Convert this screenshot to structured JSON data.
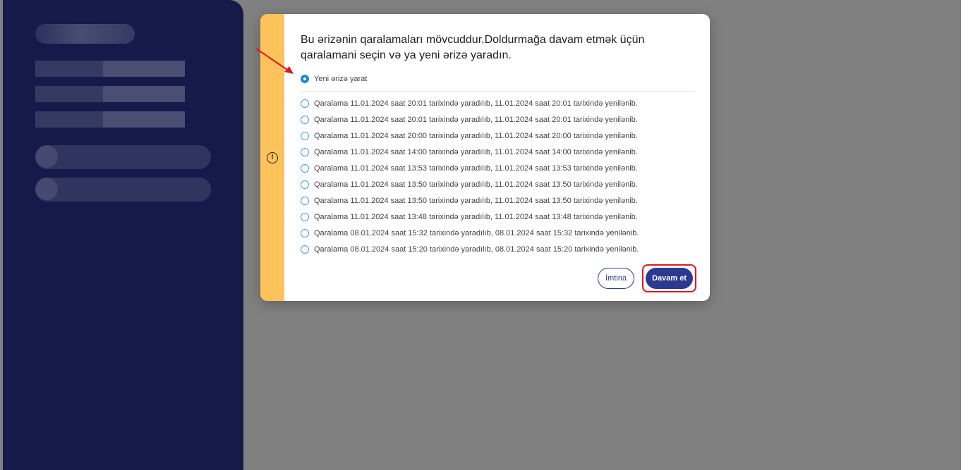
{
  "dialog": {
    "title": "Bu ərizənin qaralamaları mövcuddur.Doldurmağa davam etmək üçün qaralamani seçin və ya yeni ərizə yaradın.",
    "new_option": "Yeni ərizə yarat",
    "drafts": [
      "Qaralama 11.01.2024 saat 20:01 tarixində yaradılıb, 11.01.2024 saat 20:01 tarixində yenilənib.",
      "Qaralama 11.01.2024 saat 20:01 tarixində yaradılıb, 11.01.2024 saat 20:01 tarixində yenilənib.",
      "Qaralama 11.01.2024 saat 20:00 tarixində yaradılıb, 11.01.2024 saat 20:00 tarixində yenilənib.",
      "Qaralama 11.01.2024 saat 14:00 tarixində yaradılıb, 11.01.2024 saat 14:00 tarixində yenilənib.",
      "Qaralama 11.01.2024 saat 13:53 tarixində yaradılıb, 11.01.2024 saat 13:53 tarixində yenilənib.",
      "Qaralama 11.01.2024 saat 13:50 tarixində yaradılıb, 11.01.2024 saat 13:50 tarixində yenilənib.",
      "Qaralama 11.01.2024 saat 13:50 tarixində yaradılıb, 11.01.2024 saat 13:50 tarixində yenilənib.",
      "Qaralama 11.01.2024 saat 13:48 tarixində yaradılıb, 11.01.2024 saat 13:48 tarixində yenilənib.",
      "Qaralama 08.01.2024 saat 15:32 tarixində yaradılıb, 08.01.2024 saat 15:32 tarixində yenilənib.",
      "Qaralama 08.01.2024 saat 15:20 tarixində yaradılıb, 08.01.2024 saat 15:20 tarixində yenilənib."
    ],
    "cancel_label": "İmtina",
    "continue_label": "Davam et",
    "warning_icon": "exclamation-circle-icon"
  },
  "colors": {
    "sidebar": "#141a4a",
    "overlay": "#808080",
    "stripe": "#fdc35a",
    "primary": "#2b3a8f",
    "radio": "#1d8ad3",
    "highlight": "#e3161a"
  }
}
